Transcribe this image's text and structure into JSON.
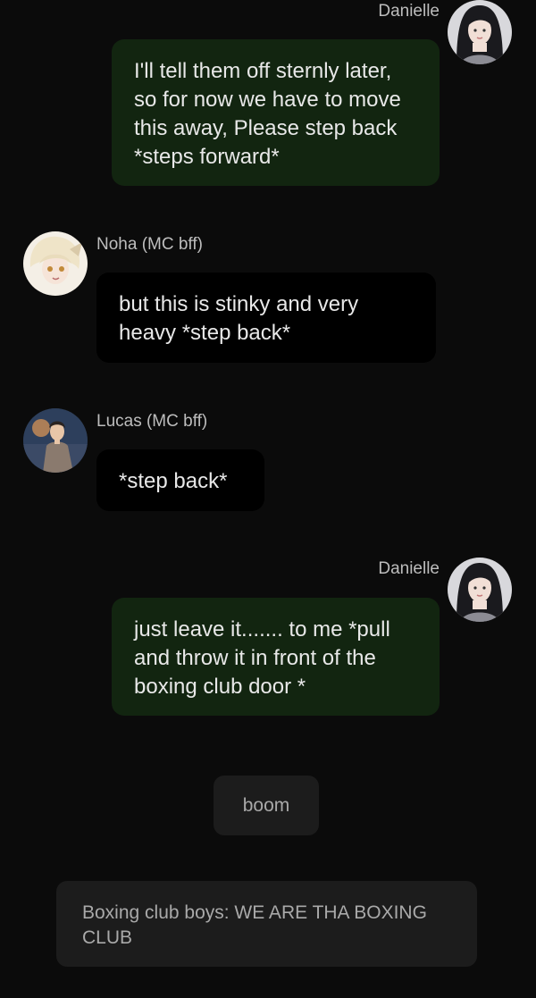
{
  "messages": [
    {
      "sender": "Danielle",
      "text": "I'll tell them off sternly later, so for now we have to move this away, Please step back *steps forward*"
    },
    {
      "sender": "Noha (MC bff)",
      "text": "but this is stinky and very heavy *step back*"
    },
    {
      "sender": "Lucas (MC bff)",
      "text": "*step back*"
    },
    {
      "sender": "Danielle",
      "text": "just leave it....... to me *pull and throw it in front of the boxing club door *"
    }
  ],
  "narration": [
    {
      "text": "boom"
    },
    {
      "text": "Boxing club boys: WE ARE THA BOXING CLUB"
    }
  ],
  "icons": {
    "danielle_avatar": "avatar-danielle-icon",
    "noha_avatar": "avatar-noha-icon",
    "lucas_avatar": "avatar-lucas-icon"
  },
  "colors": {
    "background": "#0b0b0b",
    "user_bubble": "#122510",
    "char_bubble": "#000000",
    "narration_bubble": "#1c1c1c"
  }
}
